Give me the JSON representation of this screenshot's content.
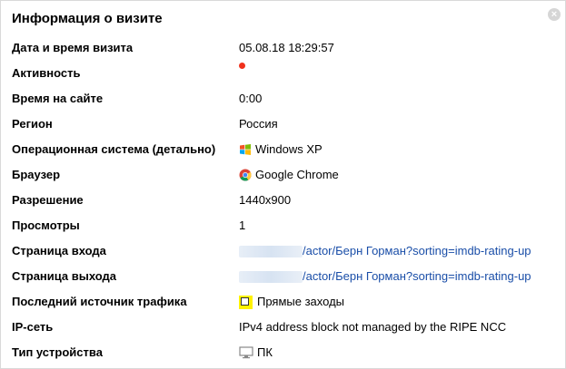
{
  "panel": {
    "title": "Информация о визите",
    "close_label": "×"
  },
  "rows": [
    {
      "label": "Дата и время визита",
      "value": "05.08.18 18:29:57"
    },
    {
      "label": "Активность",
      "value": ""
    },
    {
      "label": "Время на сайте",
      "value": "0:00"
    },
    {
      "label": "Регион",
      "value": "Россия"
    },
    {
      "label": "Операционная система (детально)",
      "value": "Windows XP",
      "icon": "windows-icon"
    },
    {
      "label": "Браузер",
      "value": "Google Chrome",
      "icon": "chrome-icon"
    },
    {
      "label": "Разрешение",
      "value": "1440x900"
    },
    {
      "label": "Просмотры",
      "value": "1"
    },
    {
      "label": "Страница входа",
      "value": "/actor/Берн Горман?sorting=imdb-rating-up"
    },
    {
      "label": "Страница выхода",
      "value": "/actor/Берн Горман?sorting=imdb-rating-up"
    },
    {
      "label": "Последний источник трафика",
      "value": "Прямые заходы",
      "icon": "traffic-source-icon"
    },
    {
      "label": "IP-сеть",
      "value": "IPv4 address block not managed by the RIPE NCC"
    },
    {
      "label": "Тип устройства",
      "value": "ПК",
      "icon": "desktop-icon"
    }
  ],
  "colors": {
    "link": "#1a4ea8",
    "activity_dot": "#f0311c",
    "highlight": "#fff200"
  }
}
